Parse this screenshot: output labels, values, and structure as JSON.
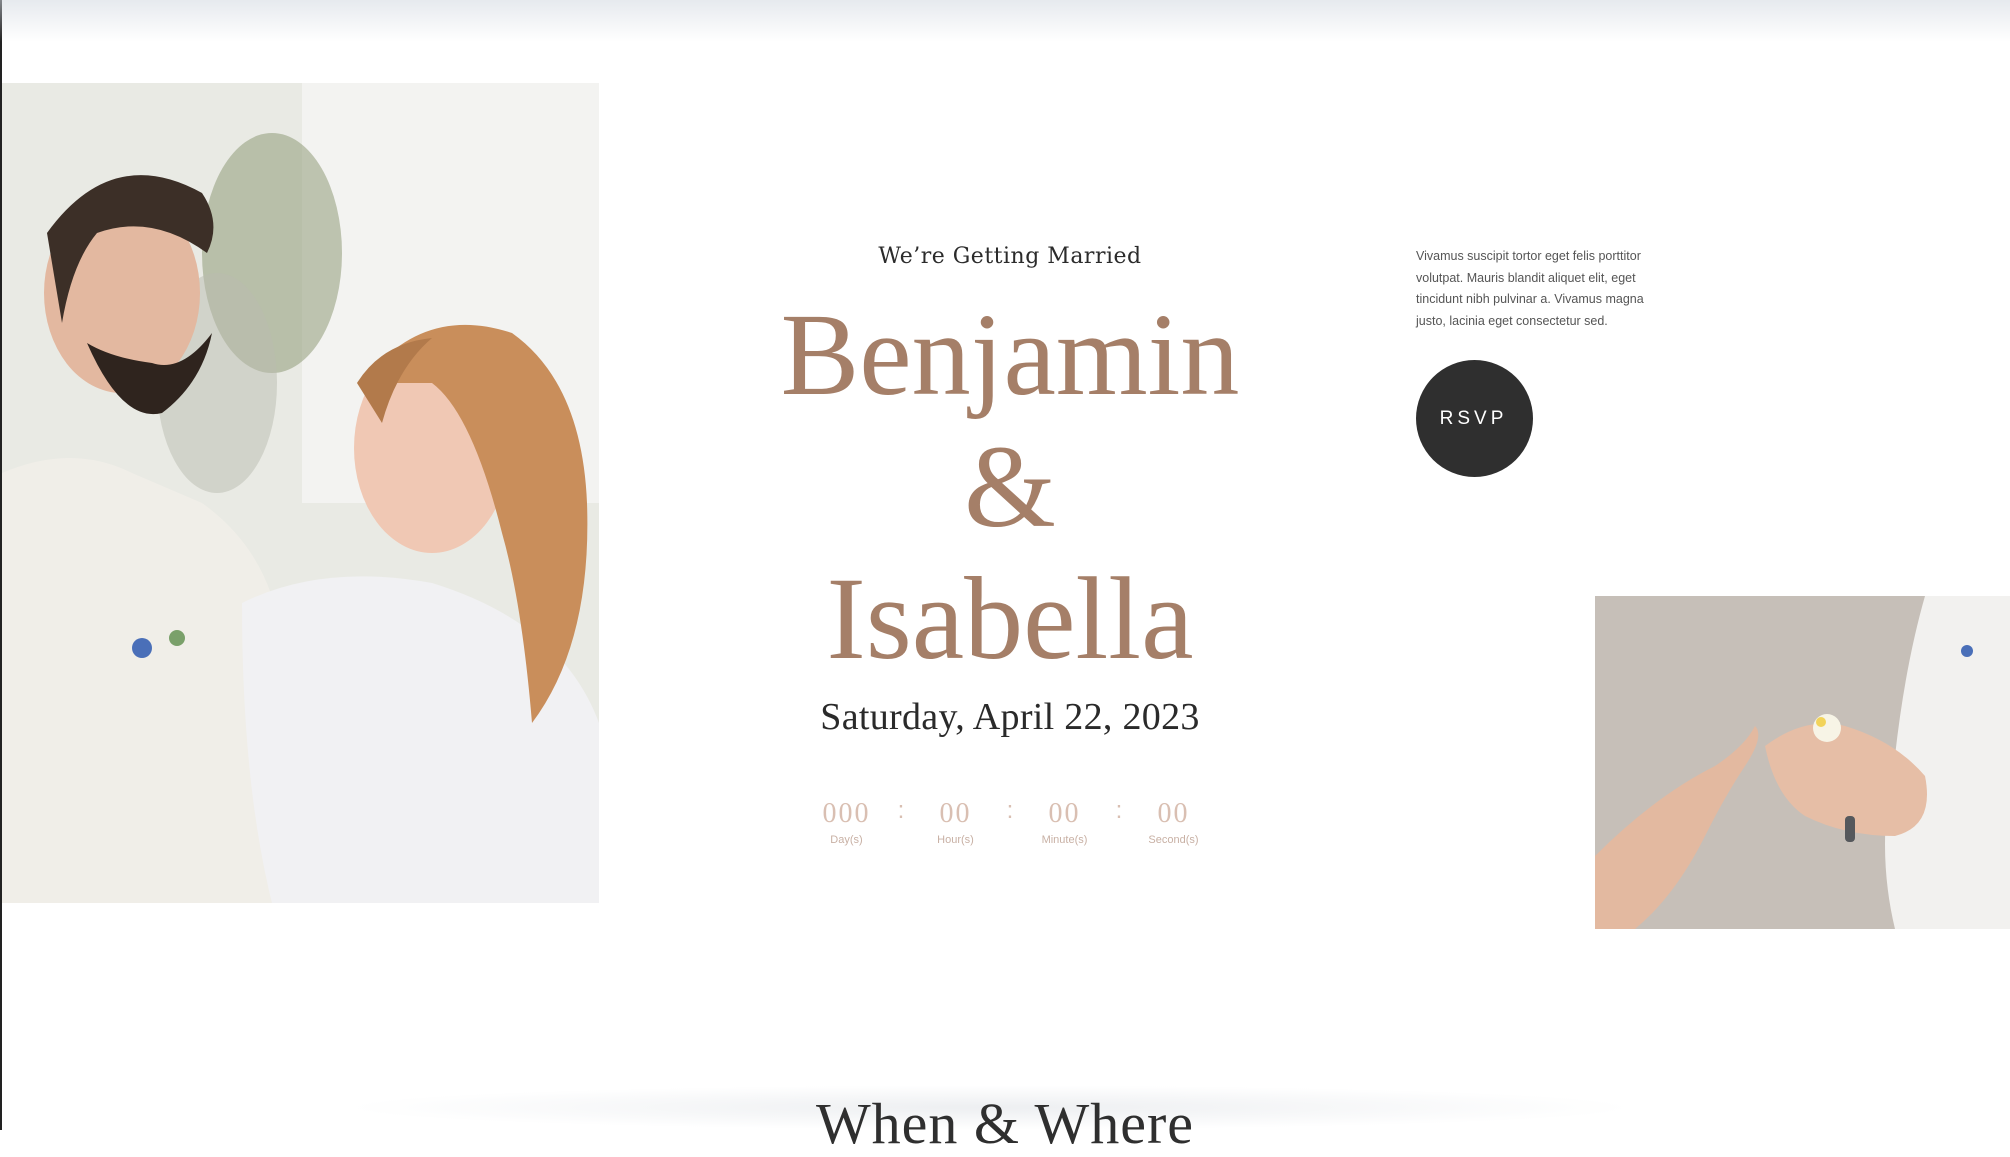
{
  "hero": {
    "eyebrow": "We’re Getting Married",
    "name_1": "Benjamin",
    "ampersand": "&",
    "name_2": "Isabella",
    "date": "Saturday, April 22, 2023"
  },
  "countdown": {
    "days": {
      "value": "000",
      "label": "Day(s)"
    },
    "hours": {
      "value": "00",
      "label": "Hour(s)"
    },
    "minutes": {
      "value": "00",
      "label": "Minute(s)"
    },
    "seconds": {
      "value": "00",
      "label": "Second(s)"
    },
    "separator": ":"
  },
  "sidebar": {
    "blurb": "Vivamus suscipit tortor eget felis porttitor volutpat. Mauris blandit aliquet elit, eget tincidunt nibh pulvinar a. Vivamus magna justo, lacinia eget consectetur sed.",
    "rsvp_label": "RSVP"
  },
  "section": {
    "heading": "When & Where"
  },
  "colors": {
    "accent": "#a57f68",
    "countdown": "#d9bfb2",
    "button_bg": "#2f2f2f"
  }
}
